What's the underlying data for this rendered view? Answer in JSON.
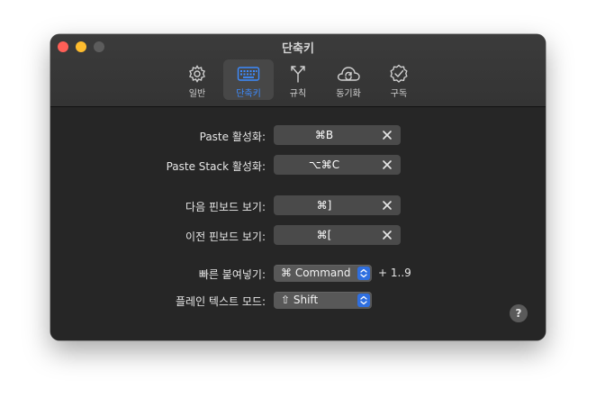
{
  "window": {
    "title": "단축키"
  },
  "tabs": [
    {
      "label": "일반",
      "icon": "gear-icon",
      "active": false
    },
    {
      "label": "단축키",
      "icon": "keyboard-icon",
      "active": true
    },
    {
      "label": "규칙",
      "icon": "branch-icon",
      "active": false
    },
    {
      "label": "동기화",
      "icon": "icloud-sync-icon",
      "active": false
    },
    {
      "label": "구독",
      "icon": "checkmark-seal-icon",
      "active": false
    }
  ],
  "shortcuts": [
    {
      "label": "Paste 활성화:",
      "keys": "⌘B"
    },
    {
      "label": "Paste Stack 활성화:",
      "keys": "⌥⌘C"
    },
    {
      "label": "다음 핀보드 보기:",
      "keys": "⌘]"
    },
    {
      "label": "이전 핀보드 보기:",
      "keys": "⌘["
    }
  ],
  "quick_paste": {
    "label": "빠른 붙여넣기:",
    "value": "⌘ Command",
    "suffix": "+ 1..9"
  },
  "plain_text": {
    "label": "플레인 텍스트 모드:",
    "value": "⇧ Shift"
  },
  "help": {
    "label": "?"
  },
  "colors": {
    "accent": "#3d8bff",
    "close": "#ff5f57",
    "minimize": "#febc2e"
  }
}
